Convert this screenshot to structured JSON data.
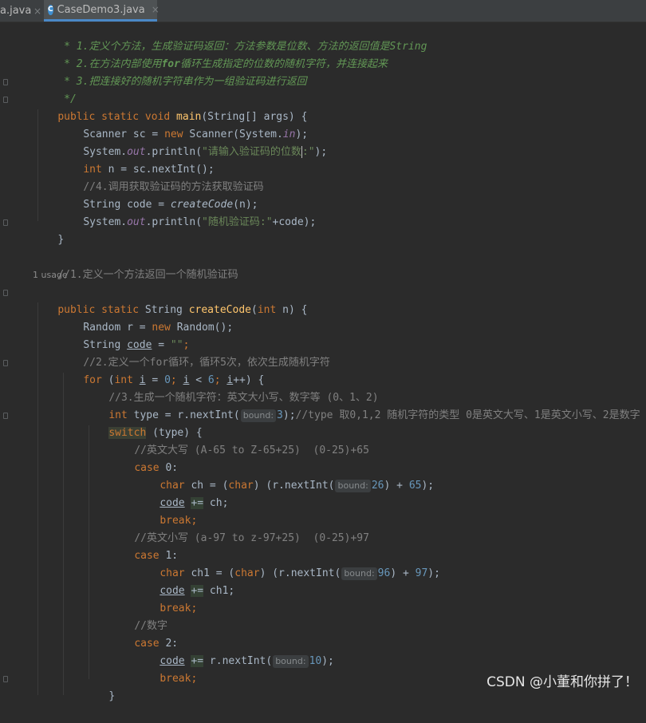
{
  "tabs": {
    "inactive_label": "a.java",
    "active_label": "CaseDemo3.java",
    "close_glyph": "×",
    "java_glyph": "C"
  },
  "code": {
    "doc1": " * 1.定义个方法，生成验证码返回：方法参数是位数、方法的返回值是String",
    "doc2a": " * 2.在方法内部使用",
    "doc2b": "for",
    "doc2c": "循环生成指定的位数的随机字符，并连接起来",
    "doc3": " * 3.把连接好的随机字符串作为一组验证码进行返回",
    "doc_end": " */",
    "kw_public": "public",
    "kw_static": "static",
    "kw_void": "void",
    "kw_new": "new",
    "kw_int": "int",
    "kw_for": "for",
    "kw_switch": "switch",
    "kw_case": "case",
    "kw_char": "char",
    "kw_break": "break",
    "main_name": "main",
    "main_params": "(String[] args) {",
    "scanner_decl": "Scanner sc = ",
    "scanner_ctor": " Scanner(System.",
    "field_in": "in",
    "close_paren_semi": ");",
    "system_dot": "System.",
    "field_out": "out",
    "println_open": ".println(",
    "str_prompt": "\"请输入验证码的位数",
    "str_prompt_end": ":\"",
    "n_decl": " n = sc.nextInt();",
    "cm4": "//4.调用获取验证码的方法获取验证码",
    "code_decl": "String code = ",
    "create_call": "createCode",
    "create_args": "(n);",
    "str_random": "\"随机验证码:\"",
    "concat_code": "+code);",
    "brace_close": "}",
    "cm1": "//1.定义一个方法返回一个随机验证码",
    "usage": "1 usage",
    "create_sig_type": " String ",
    "create_sig_name": "createCode",
    "create_sig_paren": "(",
    "create_sig_n": " n) {",
    "random_decl": "Random r = ",
    "random_ctor": " Random();",
    "string_type": "String ",
    "code_var": "code",
    "assign": " = ",
    "empty_str": "\"\"",
    "semi": ";",
    "cm2": "//2.定义一个for循环，循环5次，依次生成随机字符",
    "for_open": " (",
    "i_var": "i",
    "i_init": " = ",
    "zero": "0",
    "lt": " < ",
    "six": "6",
    "pp": "++) {",
    "cm3": "//3.生成一个随机字符：英文大小写、数字等 (0、1、2)",
    "type_decl": " type = r.nextInt(",
    "hint_bound": "bound:",
    "three": "3",
    "type_cm": "//type 取0,1,2 随机字符的类型 0是英文大写、1是英文小写、2是数字",
    "switch_arg": " (type) {",
    "cm_upper": "//英文大写 (A-65 to Z-65+25)  (0-25)+65",
    "case0": " 0:",
    "ch_decl_a": " ch = (",
    "ch_decl_b": ") (r.nextInt(",
    "n26": "26",
    "plus": ") + ",
    "n65": "65",
    "plus_eq": "+=",
    "ch_end": " ch;",
    "cm_lower": "//英文小写 (a-97 to z-97+25)  (0-25)+97",
    "case1": " 1:",
    "ch1_decl_a": " ch1 = (",
    "n96": "96",
    "n97": "97",
    "ch1_end": " ch1;",
    "cm_digit": "//数字",
    "case2": " 2:",
    "next_int": " r.nextInt(",
    "n10": "10",
    "sp_semi": ";",
    "colon": ":",
    "open_paren": "("
  },
  "watermark": "CSDN @小董和你拼了！"
}
